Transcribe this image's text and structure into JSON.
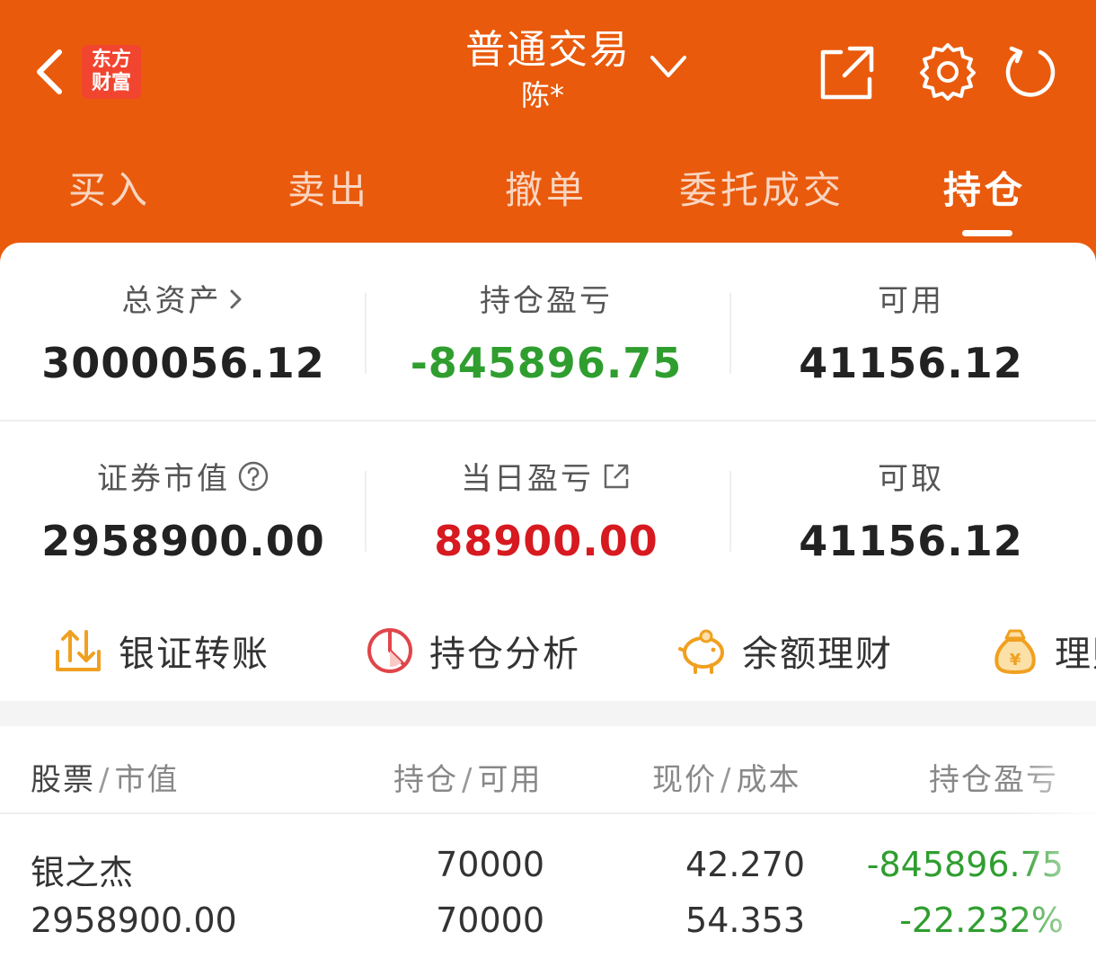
{
  "header": {
    "logo_line1": "东方",
    "logo_line2": "财富",
    "title": "普通交易",
    "account": "陈*"
  },
  "tabs": [
    "买入",
    "卖出",
    "撤单",
    "委托成交",
    "持仓"
  ],
  "active_tab": "持仓",
  "summary": {
    "total_assets_label": "总资产",
    "total_assets": "3000056.12",
    "position_pnl_label": "持仓盈亏",
    "position_pnl": "-845896.75",
    "available_label": "可用",
    "available": "41156.12",
    "market_value_label": "证券市值",
    "market_value": "2958900.00",
    "daily_pnl_label": "当日盈亏",
    "daily_pnl": "88900.00",
    "withdrawable_label": "可取",
    "withdrawable": "41156.12"
  },
  "shortcuts": [
    {
      "label": "银证转账",
      "icon": "transfer-icon"
    },
    {
      "label": "持仓分析",
      "icon": "pie-chart-icon"
    },
    {
      "label": "余额理财",
      "icon": "piggy-bank-icon"
    },
    {
      "label": "理财",
      "icon": "money-bag-icon"
    }
  ],
  "table": {
    "col1_main": "股票",
    "col1_sub": "市值",
    "col2_main": "持仓",
    "col2_sub": "可用",
    "col3_main": "现价",
    "col3_sub": "成本",
    "col4_main": "持仓盈亏",
    "sep": "/",
    "rows": [
      {
        "name": "银之杰",
        "market_value": "2958900.00",
        "position": "70000",
        "available": "70000",
        "price": "42.270",
        "cost": "54.353",
        "pnl": "-845896.75",
        "pnl_pct": "-22.232%"
      }
    ]
  },
  "colors": {
    "brand": "#e95a0c",
    "loss": "#2f9e2f",
    "gain": "#d71920"
  }
}
